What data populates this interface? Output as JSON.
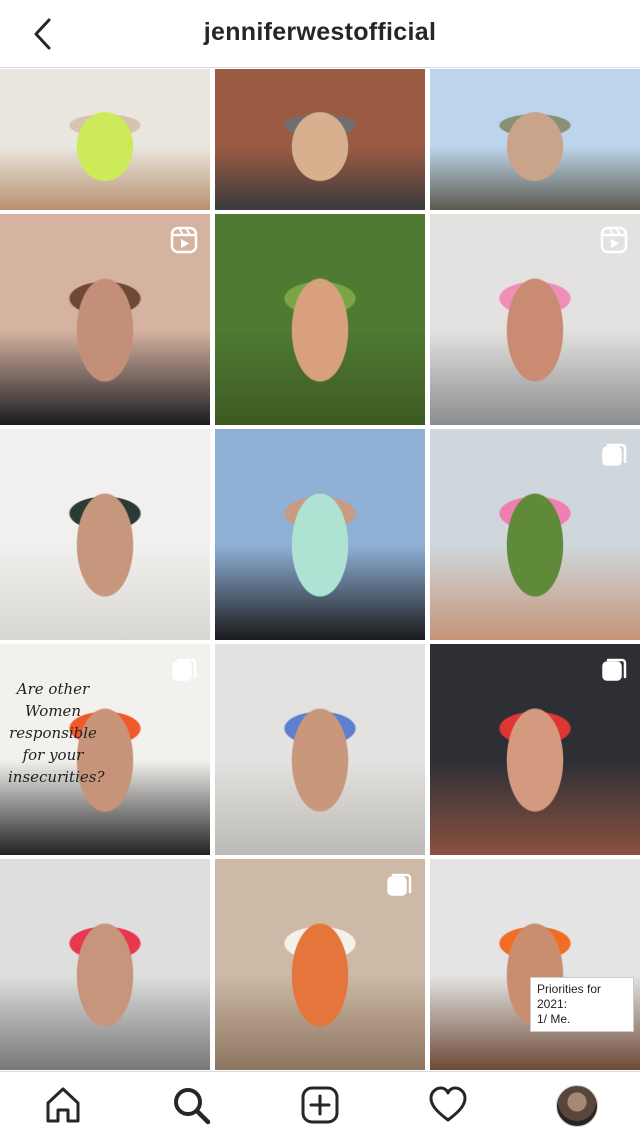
{
  "header": {
    "username": "jenniferwestofficial"
  },
  "grid": {
    "tiles": [
      {
        "badge": "none",
        "palette": [
          "#e9e6df",
          "#d7c4ae",
          "#cdeb58",
          "#b8916f"
        ]
      },
      {
        "badge": "none",
        "palette": [
          "#9a5b42",
          "#6f6f72",
          "#d9b08e",
          "#3a3a3e"
        ]
      },
      {
        "badge": "none",
        "palette": [
          "#bcd5ea",
          "#8a8f75",
          "#c9a48a",
          "#5c5a4e"
        ]
      },
      {
        "badge": "reel-icon",
        "palette": [
          "#d6b3a0",
          "#6e4a36",
          "#c48f78",
          "#1c1c22"
        ]
      },
      {
        "badge": "none",
        "palette": [
          "#4f7a32",
          "#7aa447",
          "#d8a07c",
          "#3c5a22"
        ]
      },
      {
        "badge": "reel-icon",
        "palette": [
          "#e4e2e0",
          "#ef8fb6",
          "#c98c72",
          "#8a8c8e"
        ]
      },
      {
        "badge": "none",
        "palette": [
          "#f1f0ee",
          "#2c3a34",
          "#c6977c",
          "#d8d6d3"
        ]
      },
      {
        "badge": "none",
        "palette": [
          "#8fb1d6",
          "#c79c80",
          "#aee3d4",
          "#1a1a1c"
        ]
      },
      {
        "badge": "carousel-icon",
        "palette": [
          "#cfd7dc",
          "#ee7fb0",
          "#5f8a3a",
          "#c59478"
        ]
      },
      {
        "badge": "carousel-icon",
        "palette": [
          "#f3f1ee",
          "#f05a2a",
          "#c89479",
          "#222"
        ],
        "text": [
          "Are other",
          "Women",
          "responsible",
          "for your",
          "insecurities?"
        ]
      },
      {
        "badge": "none",
        "palette": [
          "#e3e2e0",
          "#5c7fd0",
          "#c9977c",
          "#bcbab6"
        ]
      },
      {
        "badge": "carousel-icon",
        "palette": [
          "#2d2f35",
          "#e03535",
          "#d49a80",
          "#8a5140"
        ]
      },
      {
        "badge": "none",
        "palette": [
          "#dfdede",
          "#e8384f",
          "#c7957c",
          "#777"
        ]
      },
      {
        "badge": "carousel-icon",
        "palette": [
          "#cdb9a6",
          "#f3f1ea",
          "#e5753a",
          "#8d7560"
        ]
      },
      {
        "badge": "none",
        "palette": [
          "#e4e4e4",
          "#f06d23",
          "#c98e70",
          "#6d4a36"
        ],
        "text": [
          "Priorities for 2021:",
          "1/ Me."
        ]
      }
    ]
  },
  "nav": {
    "items": [
      "home-icon",
      "search-icon",
      "new-post-icon",
      "activity-heart-icon",
      "profile-avatar"
    ],
    "active": "search-icon"
  }
}
